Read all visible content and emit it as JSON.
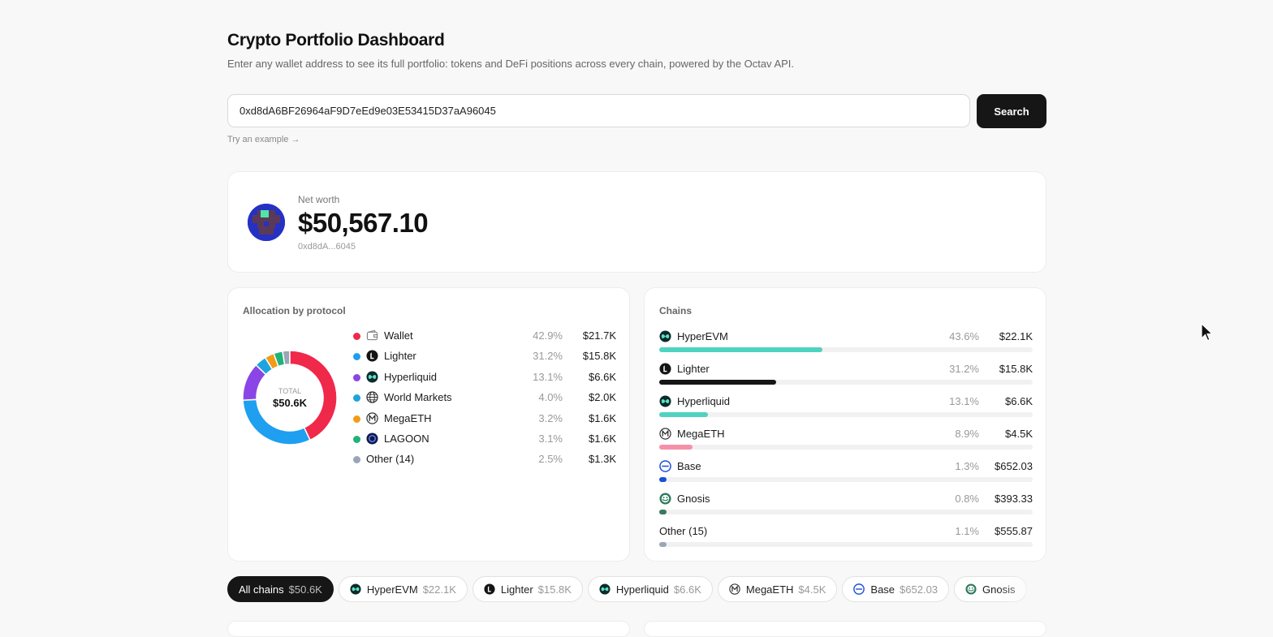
{
  "header": {
    "title": "Crypto Portfolio Dashboard",
    "subtitle": "Enter any wallet address to see its full portfolio: tokens and DeFi positions across every chain, powered by the Octav API."
  },
  "search": {
    "value": "0xd8dA6BF26964aF9D7eEd9e03E53415D37aA96045",
    "button_label": "Search",
    "example_link": "Try an example →"
  },
  "networth": {
    "label": "Net worth",
    "value": "$50,567.10",
    "address": "0xd8dA...6045"
  },
  "allocation": {
    "title": "Allocation by protocol",
    "total_label": "TOTAL",
    "total_value": "$50.6K",
    "items": [
      {
        "name": "Wallet",
        "pct": "42.9%",
        "value": "$21.7K",
        "color": "#f0284a",
        "icon": "wallet-icon"
      },
      {
        "name": "Lighter",
        "pct": "31.2%",
        "value": "$15.8K",
        "color": "#1e9ff0",
        "icon": "lighter-icon"
      },
      {
        "name": "Hyperliquid",
        "pct": "13.1%",
        "value": "$6.6K",
        "color": "#8b45e6",
        "icon": "hyperliquid-icon"
      },
      {
        "name": "World Markets",
        "pct": "4.0%",
        "value": "$2.0K",
        "color": "#1fa3e0",
        "icon": "globe-icon"
      },
      {
        "name": "MegaETH",
        "pct": "3.2%",
        "value": "$1.6K",
        "color": "#f29b18",
        "icon": "megaeth-icon"
      },
      {
        "name": "LAGOON",
        "pct": "3.1%",
        "value": "$1.6K",
        "color": "#1fb27a",
        "icon": "lagoon-icon"
      },
      {
        "name": "Other (14)",
        "pct": "2.5%",
        "value": "$1.3K",
        "color": "#9aa5b8",
        "icon": ""
      }
    ]
  },
  "chains": {
    "title": "Chains",
    "items": [
      {
        "name": "HyperEVM",
        "pct": "43.6%",
        "value": "$22.1K",
        "fraction": 0.436,
        "color": "#4fd3c0",
        "icon": "hyperevm-icon"
      },
      {
        "name": "Lighter",
        "pct": "31.2%",
        "value": "$15.8K",
        "fraction": 0.312,
        "color": "#161616",
        "icon": "lighter-icon"
      },
      {
        "name": "Hyperliquid",
        "pct": "13.1%",
        "value": "$6.6K",
        "fraction": 0.131,
        "color": "#4fd3c0",
        "icon": "hyperliquid-icon"
      },
      {
        "name": "MegaETH",
        "pct": "8.9%",
        "value": "$4.5K",
        "fraction": 0.089,
        "color": "#f590a8",
        "icon": "megaeth-icon"
      },
      {
        "name": "Base",
        "pct": "1.3%",
        "value": "$652.03",
        "fraction": 0.018,
        "color": "#1c4fd8",
        "icon": "base-icon"
      },
      {
        "name": "Gnosis",
        "pct": "0.8%",
        "value": "$393.33",
        "fraction": 0.018,
        "color": "#3a7860",
        "icon": "gnosis-icon"
      },
      {
        "name": "Other (15)",
        "pct": "1.1%",
        "value": "$555.87",
        "fraction": 0.018,
        "color": "#9aa5b8",
        "icon": ""
      }
    ]
  },
  "filters": [
    {
      "name": "All chains",
      "value": "$50.6K",
      "active": true,
      "icon": ""
    },
    {
      "name": "HyperEVM",
      "value": "$22.1K",
      "active": false,
      "icon": "hyperevm-icon"
    },
    {
      "name": "Lighter",
      "value": "$15.8K",
      "active": false,
      "icon": "lighter-icon"
    },
    {
      "name": "Hyperliquid",
      "value": "$6.6K",
      "active": false,
      "icon": "hyperliquid-icon"
    },
    {
      "name": "MegaETH",
      "value": "$4.5K",
      "active": false,
      "icon": "megaeth-icon"
    },
    {
      "name": "Base",
      "value": "$652.03",
      "active": false,
      "icon": "base-icon"
    },
    {
      "name": "Gnosis",
      "value": "",
      "active": false,
      "icon": "gnosis-icon"
    }
  ]
}
